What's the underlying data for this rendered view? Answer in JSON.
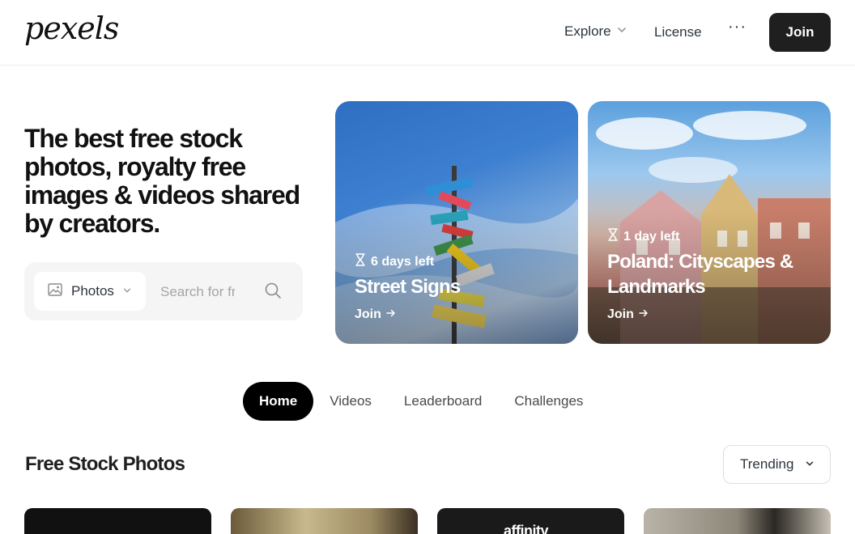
{
  "header": {
    "logo": "pexels",
    "nav": {
      "explore": "Explore",
      "license": "License",
      "more": "···"
    },
    "join_label": "Join"
  },
  "hero": {
    "title": "The best free stock photos, royalty free images & videos shared by creators.",
    "search": {
      "type_label": "Photos",
      "placeholder": "Search for free photos"
    }
  },
  "challenges": [
    {
      "time_left": "6 days left",
      "title": "Street Signs",
      "join_label": "Join"
    },
    {
      "time_left": "1 day left",
      "title": "Poland: Cityscapes & Landmarks",
      "join_label": "Join"
    }
  ],
  "tabs": [
    {
      "label": "Home",
      "active": true
    },
    {
      "label": "Videos",
      "active": false
    },
    {
      "label": "Leaderboard",
      "active": false
    },
    {
      "label": "Challenges",
      "active": false
    }
  ],
  "section": {
    "title": "Free Stock Photos",
    "sort_label": "Trending"
  },
  "photos": {
    "photo_3_text": "affinity"
  },
  "colors": {
    "accent_dark": "#1f1f1f",
    "search_bg": "#f5f5f5"
  }
}
